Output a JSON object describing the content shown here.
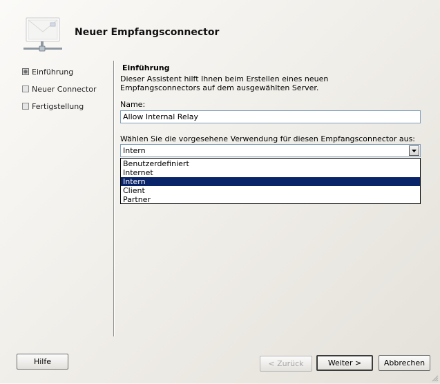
{
  "wizard": {
    "title": "Neuer Empfangsconnector"
  },
  "steps": [
    {
      "label": "Einführung",
      "active": true
    },
    {
      "label": "Neuer Connector",
      "active": false
    },
    {
      "label": "Fertigstellung",
      "active": false
    }
  ],
  "content": {
    "section_title": "Einführung",
    "intro_text": "Dieser Assistent hilft Ihnen beim Erstellen eines neuen Empfangsconnectors auf dem ausgewählten Server.",
    "name_label": "Name:",
    "name_value": "Allow Internal Relay",
    "usage_label": "Wählen Sie die vorgesehene Verwendung für diesen Empfangsconnector aus:",
    "usage_selected": "Intern",
    "usage_options": [
      "Benutzerdefiniert",
      "Internet",
      "Intern",
      "Client",
      "Partner"
    ]
  },
  "buttons": {
    "help": "Hilfe",
    "back": "< Zurück",
    "next": "Weiter >",
    "cancel": "Abbrechen"
  }
}
